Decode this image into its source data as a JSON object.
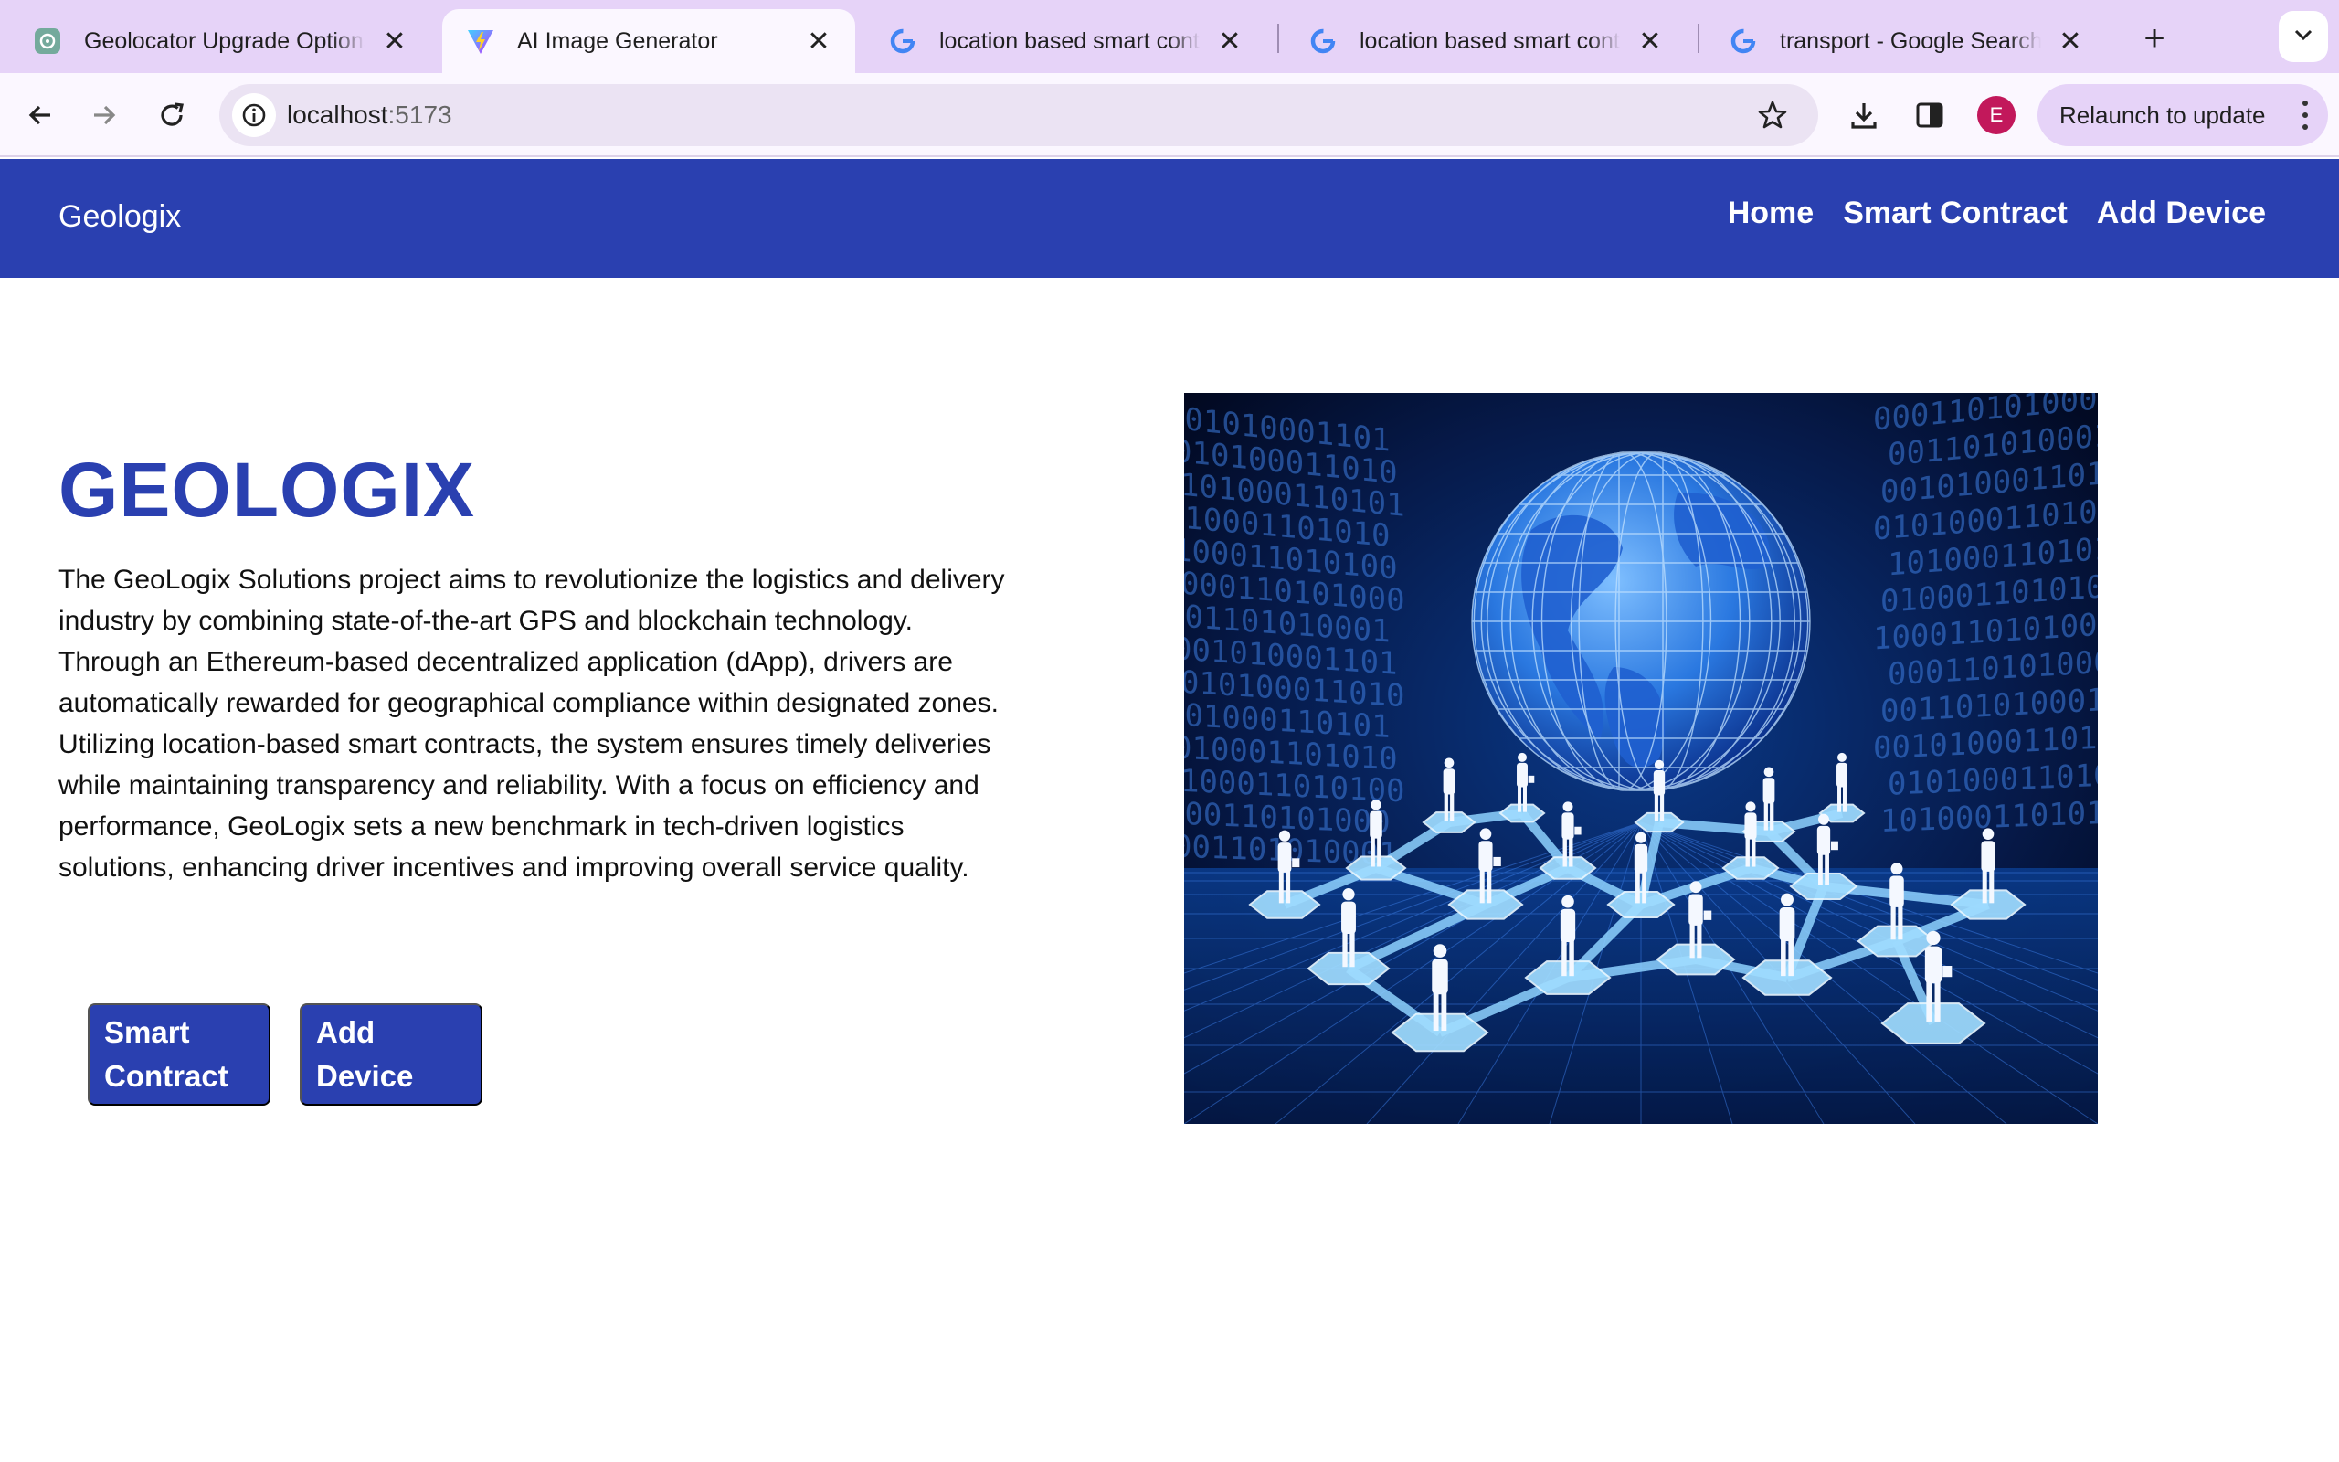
{
  "browser": {
    "tabs": [
      {
        "title": "Geolocator Upgrade Options",
        "icon": "chatgpt-icon",
        "active": false
      },
      {
        "title": "AI Image Generator",
        "icon": "vite-icon",
        "active": true
      },
      {
        "title": "location based smart contract",
        "icon": "google-icon",
        "active": false
      },
      {
        "title": "location based smart contract",
        "icon": "google-icon",
        "active": false
      },
      {
        "title": "transport - Google Search",
        "icon": "google-icon",
        "active": false
      }
    ],
    "url_host": "localhost",
    "url_port": ":5173",
    "profile_initial": "E",
    "relaunch_label": "Relaunch to update"
  },
  "nav": {
    "brand": "Geologix",
    "links": [
      "Home",
      "Smart Contract",
      "Add Device"
    ]
  },
  "hero": {
    "title": "GEOLOGIX",
    "description": "The GeoLogix Solutions project aims to revolutionize the logistics and delivery industry by combining state-of-the-art GPS and blockchain technology. Through an Ethereum-based decentralized application (dApp), drivers are automatically rewarded for geographical compliance within designated zones. Utilizing location-based smart contracts, the system ensures timely deliveries while maintaining transparency and reliability. With a focus on efficiency and performance, GeoLogix sets a new benchmark in tech-driven logistics solutions, enhancing driver incentives and improving overall service quality.",
    "buttons": [
      "Smart Contract",
      "Add Device"
    ],
    "image_binary": "0010100011010100010110100110100010110011010001011010010"
  },
  "colors": {
    "brand_blue": "#2a40b0",
    "tabstrip": "#e6d3f8",
    "profile": "#c2185b"
  }
}
